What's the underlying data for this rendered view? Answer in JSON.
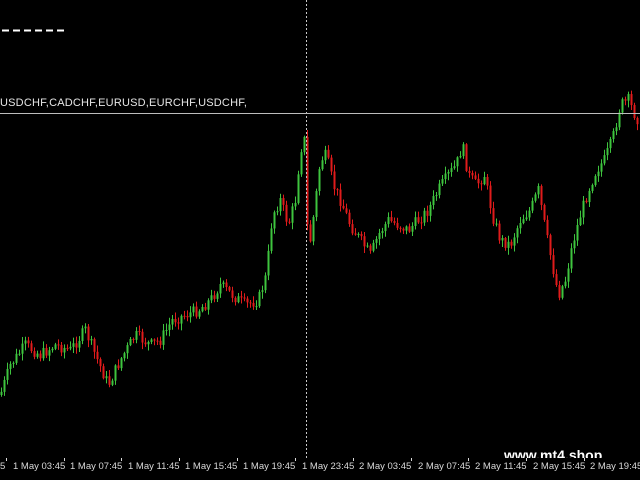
{
  "colors": {
    "background": "#000000",
    "bull_candle": "#3ec43e",
    "bear_candle": "#e01b1b",
    "crosshair": "#c8c8c8",
    "level_line": "#bdbdbd",
    "text": "#e6e6e6"
  },
  "indicator_label": "USDCHF,CADCHF,EURUSD,EURCHF,USDCHF,",
  "watermark": "www.mt4.shop",
  "time_axis": {
    "labels": [
      "1 May 03:45",
      "1 May 07:45",
      "1 May 11:45",
      "1 May 15:45",
      "1 May 19:45",
      "1 May 23:45",
      "2 May 03:45",
      "2 May 07:45",
      "2 May 11:45",
      "2 May 15:45",
      "2 May 19:45"
    ],
    "partial_left_label": "5"
  },
  "crosshair_time_index": 306
}
